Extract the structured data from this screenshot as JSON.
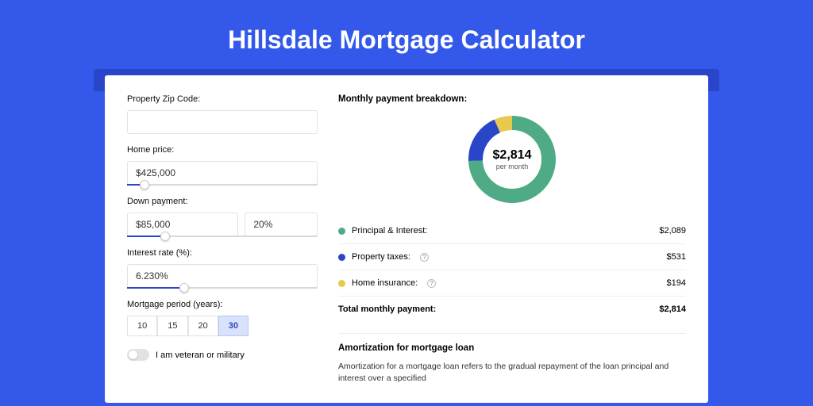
{
  "page_title": "Hillsdale Mortgage Calculator",
  "form": {
    "zip_label": "Property Zip Code:",
    "zip_value": "",
    "home_price_label": "Home price:",
    "home_price_value": "$425,000",
    "down_payment_label": "Down payment:",
    "down_payment_value": "$85,000",
    "down_payment_pct": "20%",
    "interest_label": "Interest rate (%):",
    "interest_value": "6.230%",
    "period_label": "Mortgage period (years):",
    "period_options": [
      "10",
      "15",
      "20",
      "30"
    ],
    "period_selected": "30",
    "veteran_label": "I am veteran or military"
  },
  "breakdown": {
    "title": "Monthly payment breakdown:",
    "center_amount": "$2,814",
    "center_sub": "per month",
    "items": [
      {
        "label": "Principal & Interest:",
        "value": "$2,089",
        "color": "g",
        "info": false
      },
      {
        "label": "Property taxes:",
        "value": "$531",
        "color": "b",
        "info": true
      },
      {
        "label": "Home insurance:",
        "value": "$194",
        "color": "y",
        "info": true
      }
    ],
    "total_label": "Total monthly payment:",
    "total_value": "$2,814"
  },
  "amortization": {
    "title": "Amortization for mortgage loan",
    "text": "Amortization for a mortgage loan refers to the gradual repayment of the loan principal and interest over a specified"
  },
  "chart_data": {
    "type": "pie",
    "title": "Monthly payment breakdown",
    "series": [
      {
        "name": "Principal & Interest",
        "value": 2089,
        "color": "#4fab86"
      },
      {
        "name": "Property taxes",
        "value": 531,
        "color": "#2946c9"
      },
      {
        "name": "Home insurance",
        "value": 194,
        "color": "#e8c94e"
      }
    ],
    "total": 2814,
    "center_label": "$2,814 per month"
  }
}
